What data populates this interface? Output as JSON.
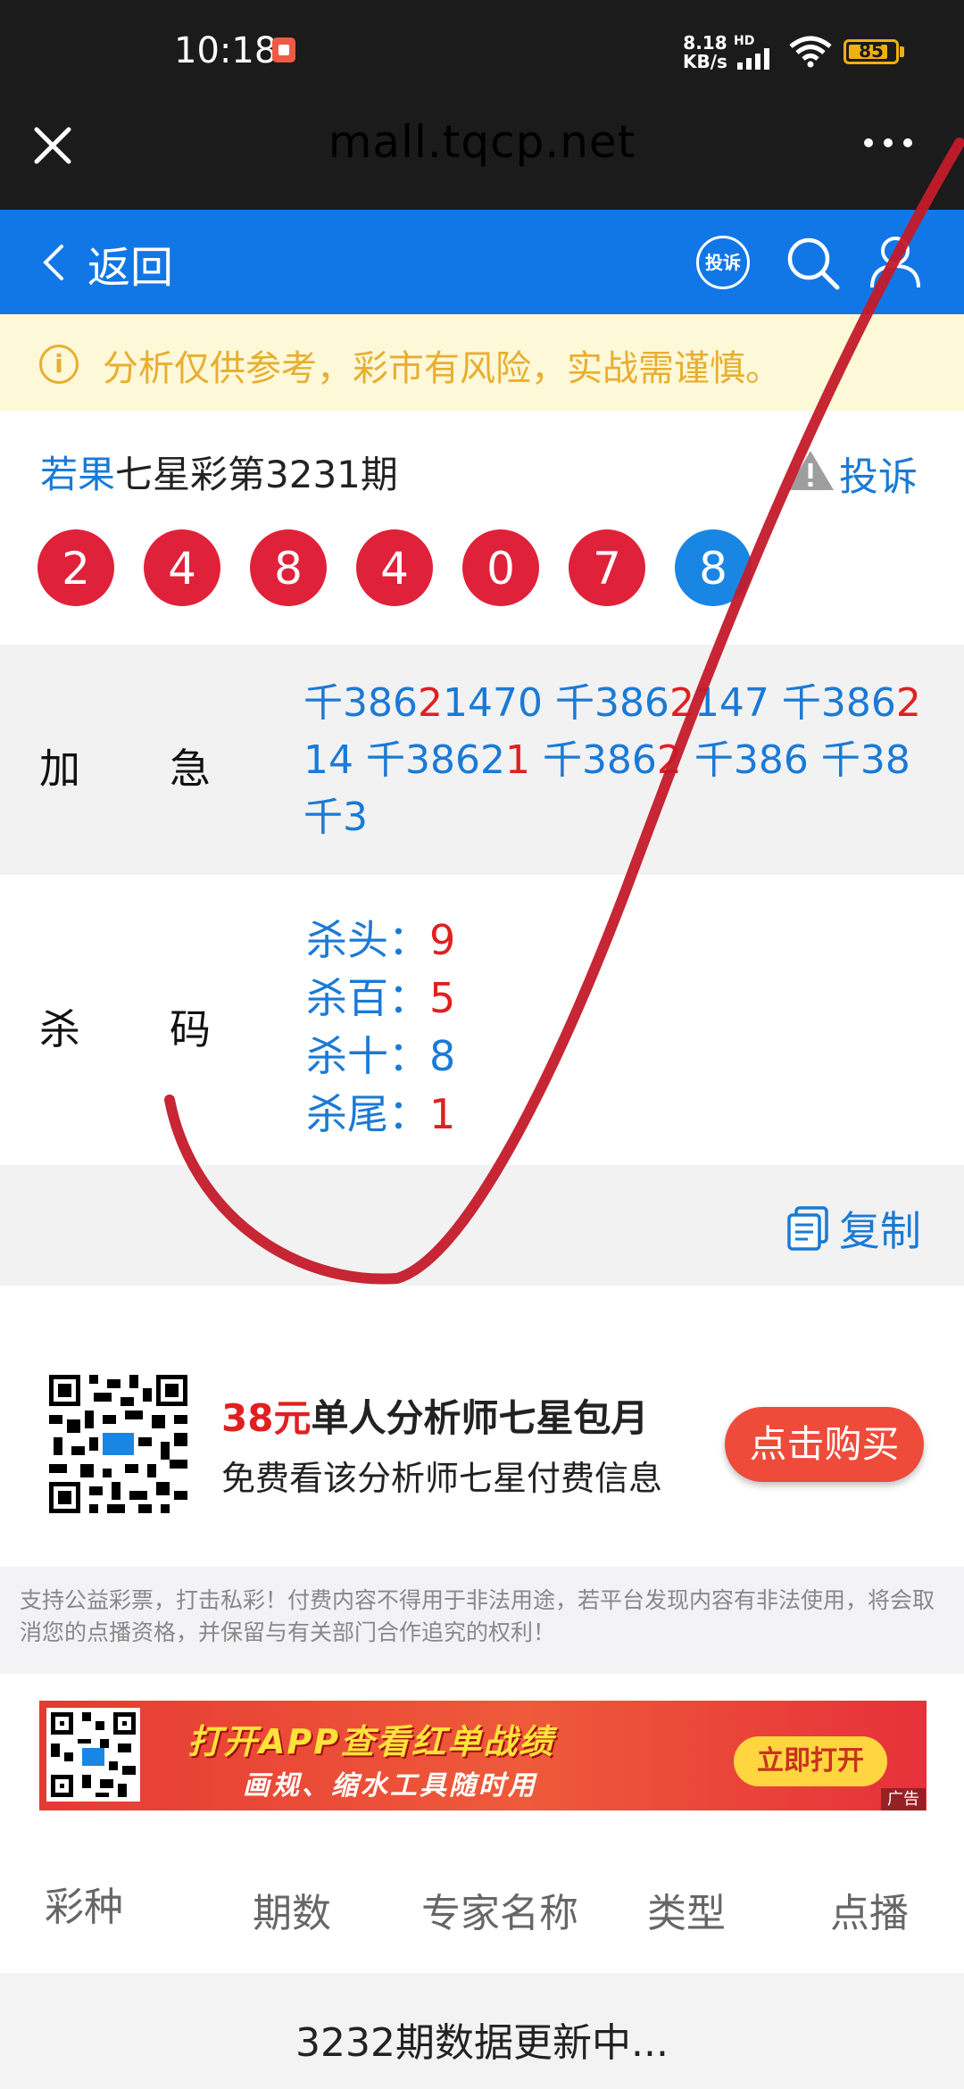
{
  "status_bar": {
    "time": "10:18",
    "net_speed_value": "8.18",
    "net_speed_unit": "KB/s",
    "hd_label": "HD",
    "battery_level": 85,
    "battery_text": "85"
  },
  "browser": {
    "domain": "mall.tqcp.net"
  },
  "nav": {
    "back_label": "返回",
    "complain_badge": "投诉"
  },
  "warning": {
    "text": "分析仅供参考，彩市有风险，实战需谨慎。"
  },
  "header": {
    "author": "若果",
    "issue": "七星彩第3231期",
    "complain_label": "投诉"
  },
  "numbers": {
    "balls": [
      "2",
      "4",
      "8",
      "4",
      "0",
      "7",
      "8"
    ],
    "red_color": "#e0213a",
    "blue_color": "#1a86e3"
  },
  "jiaji": {
    "label_1": "加",
    "label_2": "急",
    "parts": [
      {
        "text": "千386",
        "color": "blue"
      },
      {
        "text": "2",
        "color": "red"
      },
      {
        "text": "1470 千386",
        "color": "blue"
      },
      {
        "text": "2",
        "color": "red"
      },
      {
        "text": "147 千386",
        "color": "blue"
      },
      {
        "text": "2",
        "color": "red"
      },
      {
        "text": "14 千3862",
        "color": "blue"
      },
      {
        "text": "1",
        "color": "red"
      },
      {
        "text": " 千386",
        "color": "blue"
      },
      {
        "text": "2",
        "color": "red"
      },
      {
        "text": " 千386 千38 千3",
        "color": "blue"
      }
    ]
  },
  "kill": {
    "label_1": "杀",
    "label_2": "码",
    "items": [
      {
        "label": "杀头：",
        "value": "9",
        "color": "red"
      },
      {
        "label": "杀百：",
        "value": "5",
        "color": "red"
      },
      {
        "label": "杀十：",
        "value": "8",
        "color": "blue"
      },
      {
        "label": "杀尾：",
        "value": "1",
        "color": "red"
      }
    ]
  },
  "copy": {
    "label": "复制"
  },
  "promo": {
    "price": "38元",
    "title_rest": "单人分析师七星包月",
    "subtitle": "免费看该分析师七星付费信息",
    "button": "点击购买"
  },
  "notice": {
    "text": "支持公益彩票，打击私彩！付费内容不得用于非法用途，若平台发现内容有非法使用，将会取消您的点播资格，并保留与有关部门合作追究的权利！"
  },
  "banner": {
    "title": "打开APP查看红单战绩",
    "subtitle": "画规、缩水工具随时用",
    "button": "立即打开",
    "ad_label": "广告"
  },
  "table": {
    "headers": [
      "彩种",
      "期数",
      "专家名称",
      "类型",
      "点播"
    ],
    "updating": "3232期数据更新中..."
  }
}
